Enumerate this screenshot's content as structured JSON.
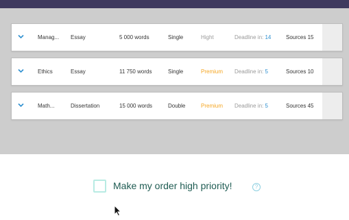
{
  "orders": [
    {
      "title": "Manag...",
      "type": "Essay",
      "words": "5 000 words",
      "spacing": "Single",
      "level": "Hight",
      "level_premium": false,
      "deadline_label": "Deadline in:",
      "deadline_value": "14",
      "sources": "Sources 15"
    },
    {
      "title": "Ethics",
      "type": "Essay",
      "words": "11 750 words",
      "spacing": "Single",
      "level": "Premium",
      "level_premium": true,
      "deadline_label": "Deadline in:",
      "deadline_value": "5",
      "sources": "Sources 10"
    },
    {
      "title": "Math...",
      "type": "Dissertation",
      "words": "15 000 words",
      "spacing": "Double",
      "level": "Premium",
      "level_premium": true,
      "deadline_label": "Deadline in:",
      "deadline_value": "5",
      "sources": "Sources 45"
    }
  ],
  "priority": {
    "label": "Make my order high priority!",
    "help": "?",
    "checked": false
  },
  "icons": {
    "row_toggle": "chevron-down-icon",
    "help": "question-circle-icon",
    "cursor": "mouse-pointer-icon"
  },
  "colors": {
    "top_bar": "#3f3a5e",
    "background_gray": "#cdcdcd",
    "accent_blue": "#2d8fd0",
    "premium_orange": "#f5a623",
    "checkbox_border": "#b8ebe3",
    "label_green": "#1e5b52"
  }
}
